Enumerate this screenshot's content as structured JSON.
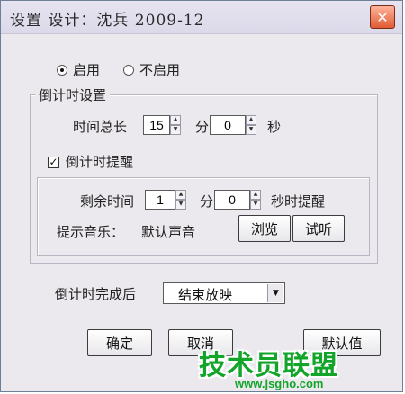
{
  "titlebar": {
    "title": "设置  设计：沈兵 2009-12",
    "close_symbol": "✕"
  },
  "mode": {
    "options": [
      {
        "label": "启用",
        "selected": true
      },
      {
        "label": "不启用",
        "selected": false
      }
    ]
  },
  "countdown_group": {
    "title": "倒计时设置",
    "total_label": "时间总长",
    "minutes_value": "15",
    "minutes_unit": "分",
    "seconds_value": "0",
    "seconds_unit": "秒",
    "reminder_check_label": "倒计时提醒",
    "reminder_checked": true
  },
  "reminder_group": {
    "remaining_label": "剩余时间",
    "minutes_value": "1",
    "minutes_unit": "分",
    "seconds_value": "0",
    "seconds_suffix": "秒时提醒",
    "music_label": "提示音乐：",
    "music_value": "默认声音",
    "browse_label": "浏览",
    "listen_label": "试听"
  },
  "after_finish": {
    "label": "倒计时完成后",
    "selected": "结束放映"
  },
  "buttons": {
    "ok": "确定",
    "cancel": "取消",
    "third": "默认值"
  },
  "watermark": {
    "text": "技术员联盟",
    "url": "www.jsgho.com"
  },
  "icons": {
    "spin_up": "▲",
    "spin_down": "▼",
    "combo_arrow": "▼",
    "check": "✓"
  },
  "colors": {
    "dialog_bg": "#ebe9ed",
    "close": "#e05b33",
    "watermark": "#12a52a"
  }
}
